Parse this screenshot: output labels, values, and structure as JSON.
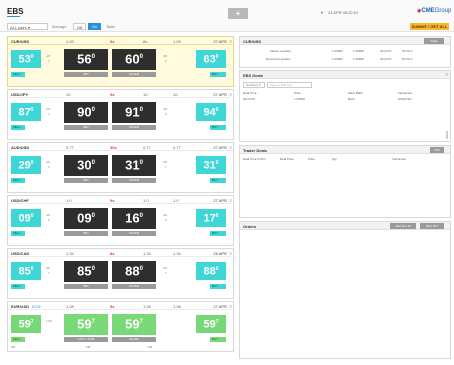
{
  "header": {
    "logo": "EBS",
    "plus": "+",
    "status": "24 APR 09:22:01",
    "brand": "CME",
    "brand_suffix": "Group",
    "select_value": "ALL pairs",
    "toolbar_label": "Manage",
    "tb_off": "Off",
    "tb_on": "On",
    "tb_todo": "Todo",
    "order_button": "SUBMIT / GET ALL"
  },
  "tiles": [
    {
      "pair": "CUR/USD",
      "sub": "",
      "left_small": "1.09",
      "mid_red": "9s",
      "right_small": "6s",
      "left_top": "1.09",
      "date": "27 APR",
      "menu": "≡",
      "sell": "53",
      "sell_sup": "0",
      "sell_sub": "",
      "bid_big": "56",
      "bid_sup": "0",
      "offer_big": "60",
      "offer_sup": "0",
      "buy": "63",
      "buy_sup": "0",
      "bid_label": "BID",
      "offer_label": "OFFER",
      "sell_btn": "SELL",
      "buy_btn": "BUY",
      "left_mid_t": "4/0",
      "left_mid_b": "3",
      "right_mid_t": "4/0",
      "right_mid_b": "3",
      "foot_left": "",
      "foot_mid": "",
      "foot_right": ""
    },
    {
      "pair": "USD/JPY",
      "sub": "",
      "left_small": "10.",
      "mid_red": "9s",
      "right_small": "10.",
      "left_top": "10.",
      "date": "27 APR",
      "menu": "≡",
      "sell": "87",
      "sell_sup": "0",
      "sell_sub": "",
      "bid_big": "90",
      "bid_sup": "0",
      "offer_big": "91",
      "offer_sup": "0",
      "buy": "94",
      "buy_sup": "0",
      "bid_label": "BID",
      "offer_label": "OFFER",
      "sell_btn": "SELL",
      "buy_btn": "BUY",
      "left_mid_t": "10/",
      "left_mid_b": "4",
      "right_mid_t": "4/0",
      "right_mid_b": "6",
      "foot_left": "",
      "foot_mid": "",
      "foot_right": ""
    },
    {
      "pair": "AUD/USD",
      "sub": "",
      "left_small": "0.77",
      "mid_red": "30s",
      "right_small": "0.77",
      "left_top": "0.77",
      "date": "27 APR",
      "menu": "≡",
      "sell": "29",
      "sell_sup": "0",
      "sell_sub": "",
      "bid_big": "30",
      "bid_sup": "0",
      "offer_big": "31",
      "offer_sup": "0",
      "buy": "31",
      "buy_sup": "0",
      "bid_label": "BID",
      "offer_label": "OFFER",
      "sell_btn": "SELL",
      "buy_btn": "BUY",
      "left_mid_t": "4/0",
      "left_mid_b": "6",
      "right_mid_t": "4/0",
      "right_mid_b": "7",
      "foot_left": "",
      "foot_mid": "",
      "foot_right": ""
    },
    {
      "pair": "USD/CHF",
      "sub": "",
      "left_small": "1.0",
      "mid_red": "9s",
      "right_small": "1.0",
      "left_top": "1.0",
      "date": "27 APR",
      "menu": "≡",
      "sell": "09",
      "sell_sup": "0",
      "sell_sub": "",
      "bid_big": "09",
      "bid_sup": "0",
      "offer_big": "16",
      "offer_sup": "0",
      "buy": "17",
      "buy_sup": "0",
      "bid_label": "BID",
      "offer_label": "OFFER",
      "sell_btn": "SELL",
      "buy_btn": "BUY",
      "left_mid_t": "4/0",
      "left_mid_b": "6",
      "right_mid_t": "4/0",
      "right_mid_b": "6",
      "foot_left": "",
      "foot_mid": "",
      "foot_right": ""
    },
    {
      "pair": "USD/CAD",
      "sub": "",
      "left_small": "1.34",
      "mid_red": "8s",
      "right_small": "1.34",
      "left_top": "1.34",
      "date": "26 APR",
      "menu": "≡",
      "sell": "85",
      "sell_sup": "0",
      "sell_sub": "",
      "bid_big": "85",
      "bid_sup": "0",
      "offer_big": "88",
      "offer_sup": "0",
      "buy": "88",
      "buy_sup": "0",
      "bid_label": "BID",
      "offer_label": "OFFER",
      "sell_btn": "SELL",
      "buy_btn": "BUY",
      "left_mid_t": "4/0",
      "left_mid_b": "7",
      "right_mid_t": "4/0",
      "right_mid_b": "7",
      "foot_left": "",
      "foot_mid": "",
      "foot_right": ""
    },
    {
      "pair": "EUR/USD",
      "sub": "ECN",
      "left_small": "1.08",
      "mid_red": "5s",
      "right_small": "1.08",
      "left_top": "1.08",
      "date": "27 APR",
      "menu": "≡",
      "sell": "59",
      "sell_sup": "7",
      "sell_sub": "5.0M",
      "bid_big": "59",
      "bid_sup": "7",
      "offer_big": "59",
      "offer_sup": "7",
      "buy": "59",
      "buy_sup": "7",
      "bid_label": "LAST • 5.0M",
      "offer_label": "Double",
      "sell_btn": "SELL",
      "buy_btn": "BUY",
      "left_mid_t": "1.08",
      "left_mid_b": "",
      "right_mid_t": "",
      "right_mid_b": "",
      "foot_left": "5M",
      "foot_mid": "1M",
      "foot_right": "1M"
    }
  ],
  "panels": {
    "currency": {
      "title": "CUR/USD",
      "btn": "Trade",
      "rows": [
        {
          "label": "Market Liquidity",
          "a": "1.09890",
          "b": "1.09895",
          "c": "09:22:01",
          "d": "25.00 m"
        },
        {
          "label": "Received Liquidity",
          "a": "1.09890",
          "b": "1.09895",
          "c": "09:22:01",
          "d": "50.00 m"
        }
      ]
    },
    "ebs_deals": {
      "title": "EBS Deals",
      "filter": "Currency",
      "search_placeholder": "Type or filter key",
      "cols": [
        "Deal Time",
        "Price",
        "Party Bank",
        "Instrument"
      ],
      "row": [
        "09:22:00",
        "1.09890",
        "Bank",
        "EUR/USD"
      ]
    },
    "trader_deals": {
      "title": "Trader Deals",
      "btn": "CSV",
      "cols": [
        "Deal Time (UTC)",
        "Deal Price",
        "Price",
        "Qty",
        "Instrument"
      ]
    },
    "orders": {
      "title": "Orders",
      "btn1": "GET ALL M",
      "btn2": "GET M/T"
    }
  },
  "colors": {
    "accent": "#2a8fd8",
    "cyan": "#3fd6d6",
    "green": "#79d979",
    "dark": "#2e2e2e",
    "order": "#f6b82a",
    "red": "#e03a3a"
  }
}
